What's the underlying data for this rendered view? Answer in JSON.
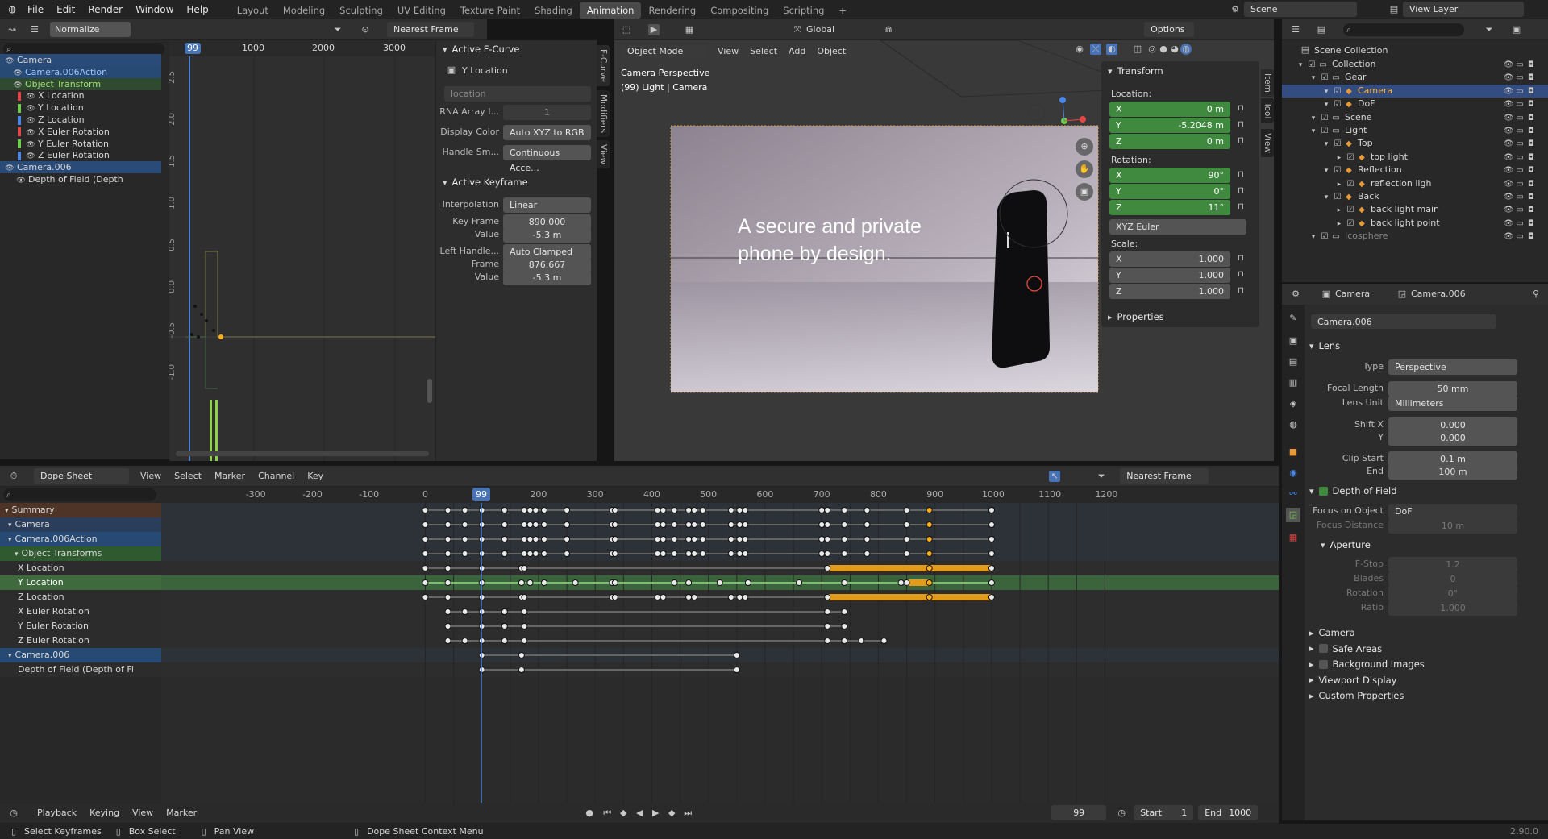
{
  "topbar": {
    "menus": [
      "File",
      "Edit",
      "Render",
      "Window",
      "Help"
    ],
    "workspaces": [
      "Layout",
      "Modeling",
      "Sculpting",
      "UV Editing",
      "Texture Paint",
      "Shading",
      "Animation",
      "Rendering",
      "Compositing",
      "Scripting"
    ],
    "active_workspace": "Animation",
    "scene": "Scene",
    "view_layer": "View Layer"
  },
  "graph": {
    "normalize": "Normalize",
    "ruler": [
      "99",
      "1000",
      "2000",
      "3000"
    ],
    "yticks": [
      "2.5",
      "2.0",
      "1.5",
      "1.0",
      "0.5",
      "0.0",
      "-0.5",
      "-1.0"
    ],
    "channels": [
      {
        "label": "Camera",
        "kind": "object"
      },
      {
        "label": "Camera.006Action",
        "kind": "action"
      },
      {
        "label": "Object Transform",
        "kind": "group"
      },
      {
        "label": "X Location",
        "kind": "x"
      },
      {
        "label": "Y Location",
        "kind": "y"
      },
      {
        "label": "Z Location",
        "kind": "z"
      },
      {
        "label": "X Euler Rotation",
        "kind": "x"
      },
      {
        "label": "Y Euler Rotation",
        "kind": "y"
      },
      {
        "label": "Z Euler Rotation",
        "kind": "z"
      },
      {
        "label": "Camera.006",
        "kind": "object"
      },
      {
        "label": "Depth of Field (Depth",
        "kind": "plain"
      }
    ]
  },
  "fcurve": {
    "active_title": "Active F-Curve",
    "channel": "Y Location",
    "path": "location",
    "rna_label": "RNA Array I...",
    "rna_value": "1",
    "display_color_label": "Display Color",
    "display_color": "Auto XYZ to RGB",
    "handle_label": "Handle Sm...",
    "handle": "Continuous Acce...",
    "kf_title": "Active Keyframe",
    "interp_label": "Interpolation",
    "interp": "Linear",
    "keyframe_label": "Key Frame",
    "keyframe": "890.000",
    "value_label": "Value",
    "value": "-5.3 m",
    "left_handle_label": "Left Handle...",
    "left_handle": "Auto Clamped",
    "frame_label": "Frame",
    "frame": "876.667",
    "value2": "-5.3 m",
    "tabs": [
      "F-Curve",
      "Modifiers",
      "View"
    ]
  },
  "viewport": {
    "mode": "Object Mode",
    "menu": [
      "View",
      "Select",
      "Add",
      "Object"
    ],
    "info1": "Camera Perspective",
    "info2": "(99) Light | Camera",
    "overlay_text_1": "A secure and private",
    "overlay_text_2": "phone by design.",
    "transform_orientation": "Global",
    "snap": "Nearest Frame",
    "options": "Options"
  },
  "npanel": {
    "title": "Transform",
    "location_label": "Location:",
    "loc": [
      {
        "k": "X",
        "v": "0 m"
      },
      {
        "k": "Y",
        "v": "-5.2048 m"
      },
      {
        "k": "Z",
        "v": "0 m"
      }
    ],
    "rotation_label": "Rotation:",
    "rot": [
      {
        "k": "X",
        "v": "90°"
      },
      {
        "k": "Y",
        "v": "0°"
      },
      {
        "k": "Z",
        "v": "11°"
      }
    ],
    "rot_mode": "XYZ Euler",
    "scale_label": "Scale:",
    "scale": [
      {
        "k": "X",
        "v": "1.000"
      },
      {
        "k": "Y",
        "v": "1.000"
      },
      {
        "k": "Z",
        "v": "1.000"
      }
    ],
    "properties": "Properties",
    "tabs": [
      "Item",
      "Tool",
      "View"
    ]
  },
  "outliner": {
    "root": "Scene Collection",
    "items": [
      {
        "label": "Collection",
        "indent": 1
      },
      {
        "label": "Gear",
        "indent": 2
      },
      {
        "label": "Camera",
        "indent": 3,
        "selected": true
      },
      {
        "label": "DoF",
        "indent": 3
      },
      {
        "label": "Scene",
        "indent": 2
      },
      {
        "label": "Light",
        "indent": 2
      },
      {
        "label": "Top",
        "indent": 3
      },
      {
        "label": "top light",
        "indent": 4
      },
      {
        "label": "Reflection",
        "indent": 3
      },
      {
        "label": "reflection ligh",
        "indent": 4
      },
      {
        "label": "Back",
        "indent": 3
      },
      {
        "label": "back light main",
        "indent": 4
      },
      {
        "label": "back light point",
        "indent": 4
      },
      {
        "label": "Icosphere",
        "indent": 2
      }
    ]
  },
  "properties": {
    "crumb_object": "Camera",
    "crumb_data": "Camera.006",
    "datablock": "Camera.006",
    "lens_title": "Lens",
    "type_label": "Type",
    "type": "Perspective",
    "focal_label": "Focal Length",
    "focal": "50 mm",
    "lens_unit_label": "Lens Unit",
    "lens_unit": "Millimeters",
    "shiftx_label": "Shift X",
    "shiftx": "0.000",
    "shifty_label": "Y",
    "shifty": "0.000",
    "clip_start_label": "Clip Start",
    "clip_start": "0.1 m",
    "clip_end_label": "End",
    "clip_end": "100 m",
    "dof_title": "Depth of Field",
    "focus_obj_label": "Focus on Object",
    "focus_obj": "DoF",
    "focus_dist_label": "Focus Distance",
    "focus_dist": "10 m",
    "aperture_title": "Aperture",
    "fstop_label": "F-Stop",
    "fstop": "1.2",
    "blades_label": "Blades",
    "blades": "0",
    "rotation_label": "Rotation",
    "rotation": "0°",
    "ratio_label": "Ratio",
    "ratio": "1.000",
    "sections": [
      "Camera",
      "Safe Areas",
      "Background Images",
      "Viewport Display",
      "Custom Properties"
    ]
  },
  "dopesheet": {
    "mode": "Dope Sheet",
    "menu": [
      "View",
      "Select",
      "Marker",
      "Channel",
      "Key"
    ],
    "snap": "Nearest Frame",
    "ruler": [
      -300,
      -200,
      -100,
      0,
      100,
      200,
      300,
      400,
      500,
      600,
      700,
      800,
      900,
      1000,
      1100,
      1200
    ],
    "current_frame": "99",
    "channels": [
      {
        "label": "Summary",
        "bg": "#4d3426"
      },
      {
        "label": "Camera",
        "bg": "#2a3d5a"
      },
      {
        "label": "Camera.006Action",
        "bg": "#274a75"
      },
      {
        "label": "Object Transforms",
        "bg": "#2f5a2f"
      },
      {
        "label": "X Location",
        "bg": "#2c2c2c"
      },
      {
        "label": "Y Location",
        "bg": "#2c2c2c",
        "active": true
      },
      {
        "label": "Z Location",
        "bg": "#2c2c2c"
      },
      {
        "label": "X Euler Rotation",
        "bg": "#2c2c2c"
      },
      {
        "label": "Y Euler Rotation",
        "bg": "#2c2c2c"
      },
      {
        "label": "Z Euler Rotation",
        "bg": "#2c2c2c"
      },
      {
        "label": "Camera.006",
        "bg": "#274a75"
      },
      {
        "label": "Depth of Field (Depth of Fi",
        "bg": "#2c2c2c"
      }
    ]
  },
  "timeline": {
    "menu": [
      "Playback",
      "Keying",
      "View",
      "Marker"
    ],
    "current": "99",
    "start_label": "Start",
    "start": "1",
    "end_label": "End",
    "end": "1000"
  },
  "status": {
    "items": [
      "Select Keyframes",
      "Box Select",
      "Pan View",
      "Dope Sheet Context Menu"
    ],
    "version": "2.90.0"
  },
  "colors": {
    "accent": "#4772b3",
    "keyframe_selected": "#ffae1f",
    "x": "#e54545",
    "y": "#6ad04a",
    "z": "#4a86e8"
  }
}
